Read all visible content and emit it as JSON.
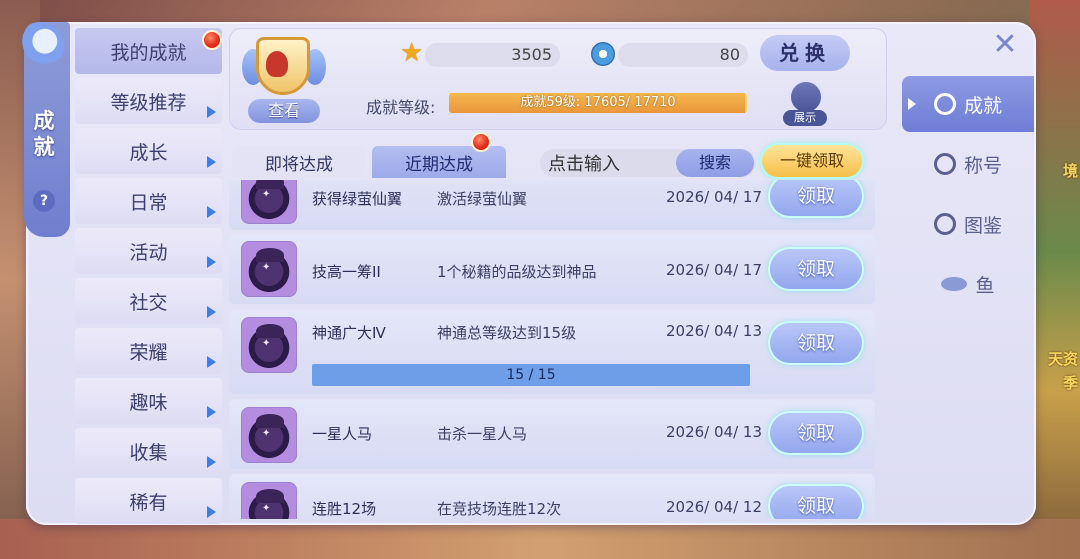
{
  "sidebar_title": "成就",
  "help_icon_label": "?",
  "categories": [
    {
      "label": "我的成就"
    },
    {
      "label": "等级推荐"
    },
    {
      "label": "成长"
    },
    {
      "label": "日常"
    },
    {
      "label": "活动"
    },
    {
      "label": "社交"
    },
    {
      "label": "荣耀"
    },
    {
      "label": "趣味"
    },
    {
      "label": "收集"
    },
    {
      "label": "稀有"
    }
  ],
  "header": {
    "view_button": "查看",
    "star_points": "3505",
    "medal_points": "80",
    "exchange_button": "兑换",
    "level_label": "成就等级:",
    "level_text": "成就59级: 17605/ 17710",
    "level_progress": 0.994,
    "showcase_label": "展示"
  },
  "tabs": {
    "upcoming": "即将达成",
    "recent": "近期达成"
  },
  "search": {
    "placeholder": "点击输入",
    "button": "搜索"
  },
  "claim_all": "一键领取",
  "rows": [
    {
      "title": "获得绿萤仙翼",
      "desc": "激活绿萤仙翼",
      "date": "2026/ 04/ 17",
      "button": "领取"
    },
    {
      "title": "技高一筹II",
      "desc": "1个秘籍的品级达到神品",
      "date": "2026/ 04/ 17",
      "button": "领取"
    },
    {
      "title": "神通广大Ⅳ",
      "desc": "神通总等级达到15级",
      "date": "2026/ 04/ 13",
      "button": "领取",
      "progress_text": "15 / 15",
      "progress": 1.0
    },
    {
      "title": "一星人马",
      "desc": "击杀一星人马",
      "date": "2026/ 04/ 13",
      "button": "领取"
    },
    {
      "title": "连胜12场",
      "desc": "在竞技场连胜12次",
      "date": "2026/ 04/ 12",
      "button": "领取"
    }
  ],
  "side_nav": [
    {
      "label": "成就"
    },
    {
      "label": "称号"
    },
    {
      "label": "图鉴"
    },
    {
      "label": "鱼"
    }
  ],
  "background_text": [
    "境",
    "天资",
    "季"
  ],
  "colors": {
    "panel": "#e3e2f6",
    "active_accent": "#7d8bdc",
    "notification": "#e2281a",
    "level_bar": "#f3d36a",
    "claim_glow": "#5ad9e8"
  }
}
